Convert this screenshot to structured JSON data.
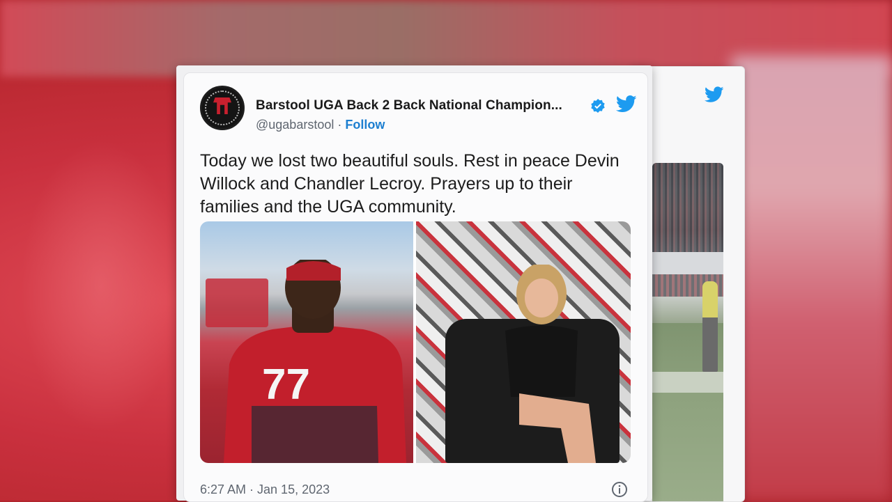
{
  "tweet": {
    "display_name": "Barstool UGA Back 2 Back National Champion...",
    "handle": "@ugabarstool",
    "separator": "·",
    "follow_label": "Follow",
    "text": "Today we lost two beautiful souls. Rest in peace Devin Willock and Chandler Lecroy. Prayers up to their families and the UGA community.",
    "timestamp": "6:27 AM · Jan 15, 2023",
    "verified": true
  },
  "icons": {
    "verified": "verified-badge-icon",
    "brand": "twitter-bird-icon",
    "info": "info-icon"
  },
  "media": {
    "left_image": "football player in red jersey number 77",
    "right_image": "young woman seated in black chair against Georgia collage wall",
    "jersey_number": "77"
  },
  "colors": {
    "twitter_blue": "#1d9bf0",
    "follow_blue": "#1d7fd0",
    "uga_red": "#c8202e"
  }
}
